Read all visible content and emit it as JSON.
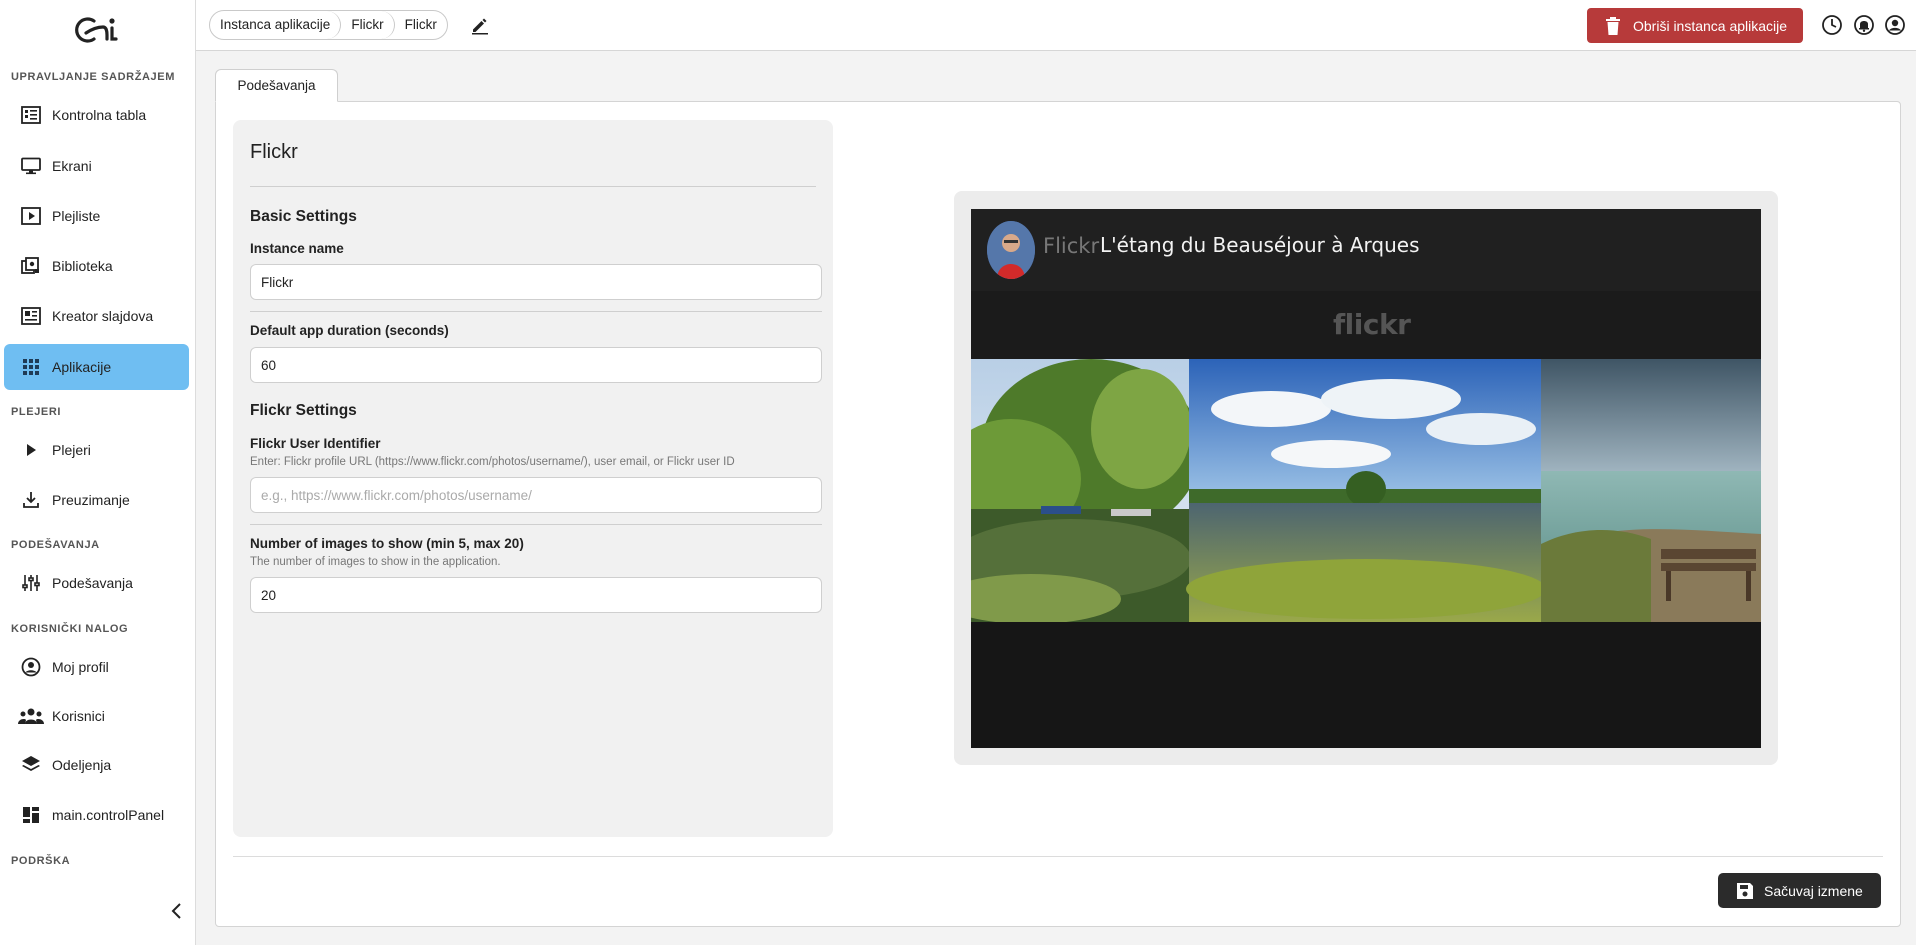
{
  "sidebar": {
    "sections": {
      "content": "UPRAVLJANJE SADRŽAJEM",
      "players": "PLEJERI",
      "settings": "PODEŠAVANJA",
      "account": "KORISNIČKI NALOG",
      "support": "PODRŠKA"
    },
    "items": [
      {
        "label": "Kontrolna tabla",
        "icon": "dashboard-icon"
      },
      {
        "label": "Ekrani",
        "icon": "monitor-icon"
      },
      {
        "label": "Plejliste",
        "icon": "playlist-icon"
      },
      {
        "label": "Biblioteka",
        "icon": "library-icon"
      },
      {
        "label": "Kreator slajdova",
        "icon": "slide-creator-icon"
      },
      {
        "label": "Aplikacije",
        "icon": "apps-grid-icon"
      },
      {
        "label": "Plejeri",
        "icon": "play-icon"
      },
      {
        "label": "Preuzimanje",
        "icon": "download-icon"
      },
      {
        "label": "Podešavanja",
        "icon": "sliders-icon"
      },
      {
        "label": "Moj profil",
        "icon": "profile-icon"
      },
      {
        "label": "Korisnici",
        "icon": "users-icon"
      },
      {
        "label": "Odeljenja",
        "icon": "layers-icon"
      },
      {
        "label": "main.controlPanel",
        "icon": "control-panel-icon"
      }
    ],
    "active_item": "Aplikacije"
  },
  "topbar": {
    "breadcrumbs": [
      "Instanca aplikacije",
      "Flickr",
      "Flickr"
    ],
    "delete_label": "Obriši instanca aplikacije"
  },
  "tabs": [
    "Podešavanja"
  ],
  "form": {
    "title": "Flickr",
    "basic_heading": "Basic Settings",
    "instance_name_label": "Instance name",
    "instance_name_value": "Flickr",
    "duration_label": "Default app duration (seconds)",
    "duration_value": "60",
    "flickr_heading": "Flickr Settings",
    "user_id_label": "Flickr User Identifier",
    "user_id_help": "Enter: Flickr profile URL (https://www.flickr.com/photos/username/), user email, or Flickr user ID",
    "user_id_placeholder": "e.g., https://www.flickr.com/photos/username/",
    "user_id_value": "",
    "num_images_label": "Number of images to show (min 5, max 20)",
    "num_images_help": "The number of images to show in the application.",
    "num_images_value": "20"
  },
  "preview": {
    "brand": "Flickr",
    "title": "L'étang du Beauséjour à Arques",
    "logo_text": "flickr"
  },
  "footer": {
    "save_label": "Sačuvaj izmene"
  },
  "colors": {
    "active_nav": "#6fbef2",
    "danger": "#b73a3a",
    "save": "#2b2b2b"
  }
}
